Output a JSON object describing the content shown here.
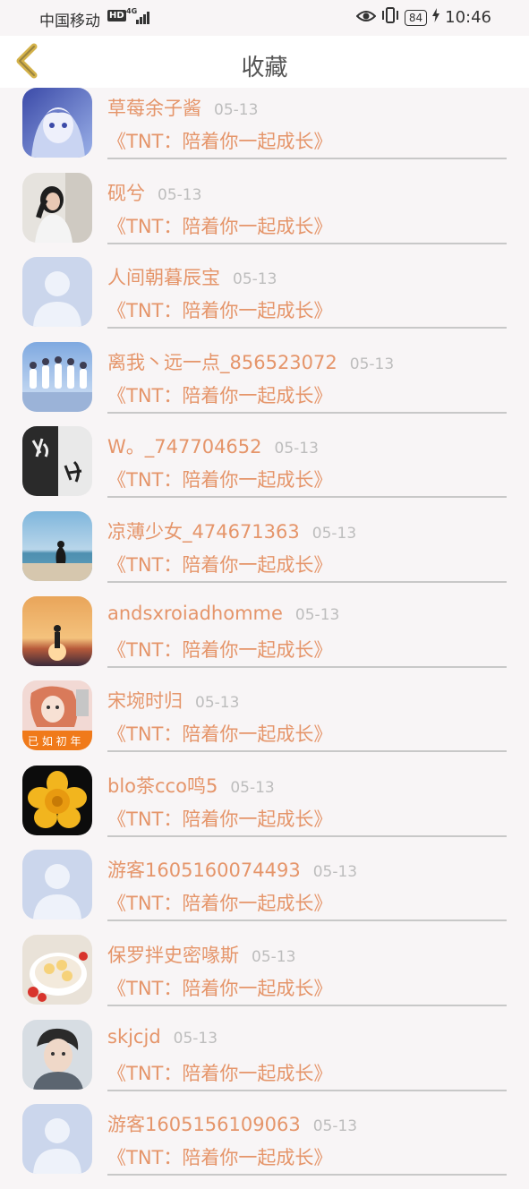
{
  "status_bar": {
    "carrier": "中国移动",
    "hd": "HD",
    "net_type": "4G",
    "battery": "84",
    "time": "10:46"
  },
  "header": {
    "title": "收藏",
    "back_icon": "chevron-left-icon"
  },
  "colors": {
    "accent": "#e5956a",
    "back_icon": "#d4b24a",
    "date": "#bdbdbd",
    "divider": "#c8c8c8"
  },
  "items": [
    {
      "user": "草莓余子酱",
      "date": "05-13",
      "book": "《TNT：陪着你一起成长》",
      "avatar": "anime"
    },
    {
      "user": "砚兮",
      "date": "05-13",
      "book": "《TNT：陪着你一起成长》",
      "avatar": "girl-photo"
    },
    {
      "user": "人间朝暮辰宝",
      "date": "05-13",
      "book": "《TNT：陪着你一起成长》",
      "avatar": "default"
    },
    {
      "user": "离我丶远一点_856523072",
      "date": "05-13",
      "book": "《TNT：陪着你一起成长》",
      "avatar": "group"
    },
    {
      "user": "W。_747704652",
      "date": "05-13",
      "book": "《TNT：陪着你一起成长》",
      "avatar": "calligraphy"
    },
    {
      "user": "凉薄少女_474671363",
      "date": "05-13",
      "book": "《TNT：陪着你一起成长》",
      "avatar": "beach"
    },
    {
      "user": "andsxroiadhomme",
      "date": "05-13",
      "book": "《TNT：陪着你一起成长》",
      "avatar": "sunset"
    },
    {
      "user": "宋埦时归",
      "date": "05-13",
      "book": "《TNT：陪着你一起成长》",
      "avatar": "girl-banner"
    },
    {
      "user": "blo茶cco鸣5",
      "date": "05-13",
      "book": "《TNT：陪着你一起成长》",
      "avatar": "flower"
    },
    {
      "user": "游客1605160074493",
      "date": "05-13",
      "book": "《TNT：陪着你一起成长》",
      "avatar": "default"
    },
    {
      "user": "保罗拌史密喙斯",
      "date": "05-13",
      "book": "《TNT：陪着你一起成长》",
      "avatar": "food"
    },
    {
      "user": "skjcjd",
      "date": "05-13",
      "book": "《TNT：陪着你一起成长》",
      "avatar": "boy"
    },
    {
      "user": "游客1605156109063",
      "date": "05-13",
      "book": "《TNT：陪着你一起成长》",
      "avatar": "default"
    }
  ]
}
